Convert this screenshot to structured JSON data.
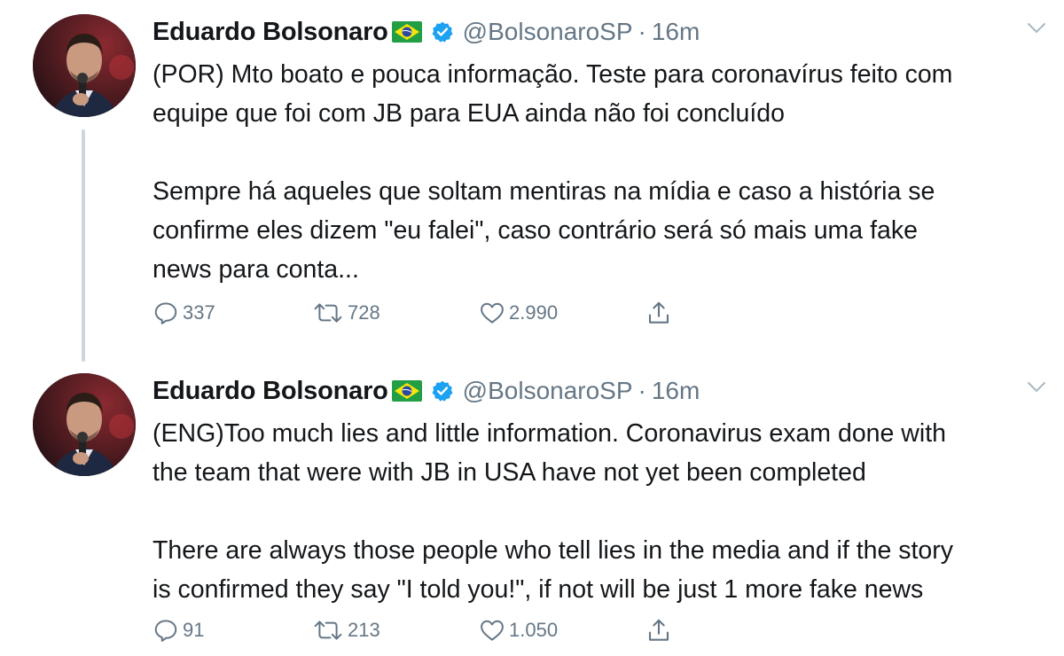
{
  "tweets": [
    {
      "author": {
        "name": "Eduardo Bolsonaro",
        "handle": "@BolsonaroSP",
        "flag_icon": "brazil-flag-icon",
        "verified_icon": "verified-badge-icon",
        "verified_color": "#1da1f2"
      },
      "separator": "·",
      "time": "16m",
      "paragraphs": [
        [
          "(POR) Mto boato e pouca informação. Teste para coronavírus feito com",
          "equipe que foi com JB para EUA ainda não foi concluído"
        ],
        [
          "Sempre há aqueles que soltam mentiras na mídia e caso a história se",
          "confirme eles dizem \"eu falei\", caso contrário será só mais uma fake",
          "news para conta..."
        ]
      ],
      "stats": {
        "replies": "337",
        "retweets": "728",
        "likes": "2.990"
      }
    },
    {
      "author": {
        "name": "Eduardo Bolsonaro",
        "handle": "@BolsonaroSP",
        "flag_icon": "brazil-flag-icon",
        "verified_icon": "verified-badge-icon",
        "verified_color": "#1da1f2"
      },
      "separator": "·",
      "time": "16m",
      "paragraphs": [
        [
          "(ENG)Too much lies and little information. Coronavirus exam done with",
          "the team that were with JB in USA have not yet been completed"
        ],
        [
          "There are always those people who tell lies in the media and if the story",
          "is confirmed they say \"I told you!\", if not will be just 1 more fake news"
        ]
      ],
      "stats": {
        "replies": "91",
        "retweets": "213",
        "likes": "1.050"
      }
    }
  ],
  "icons": {
    "reply": "reply-icon",
    "retweet": "retweet-icon",
    "like": "heart-icon",
    "share": "share-icon",
    "more": "chevron-down-icon"
  },
  "colors": {
    "text": "#14171a",
    "secondary": "#657786",
    "thread_line": "#ccd6dd",
    "verified": "#1da1f2"
  }
}
